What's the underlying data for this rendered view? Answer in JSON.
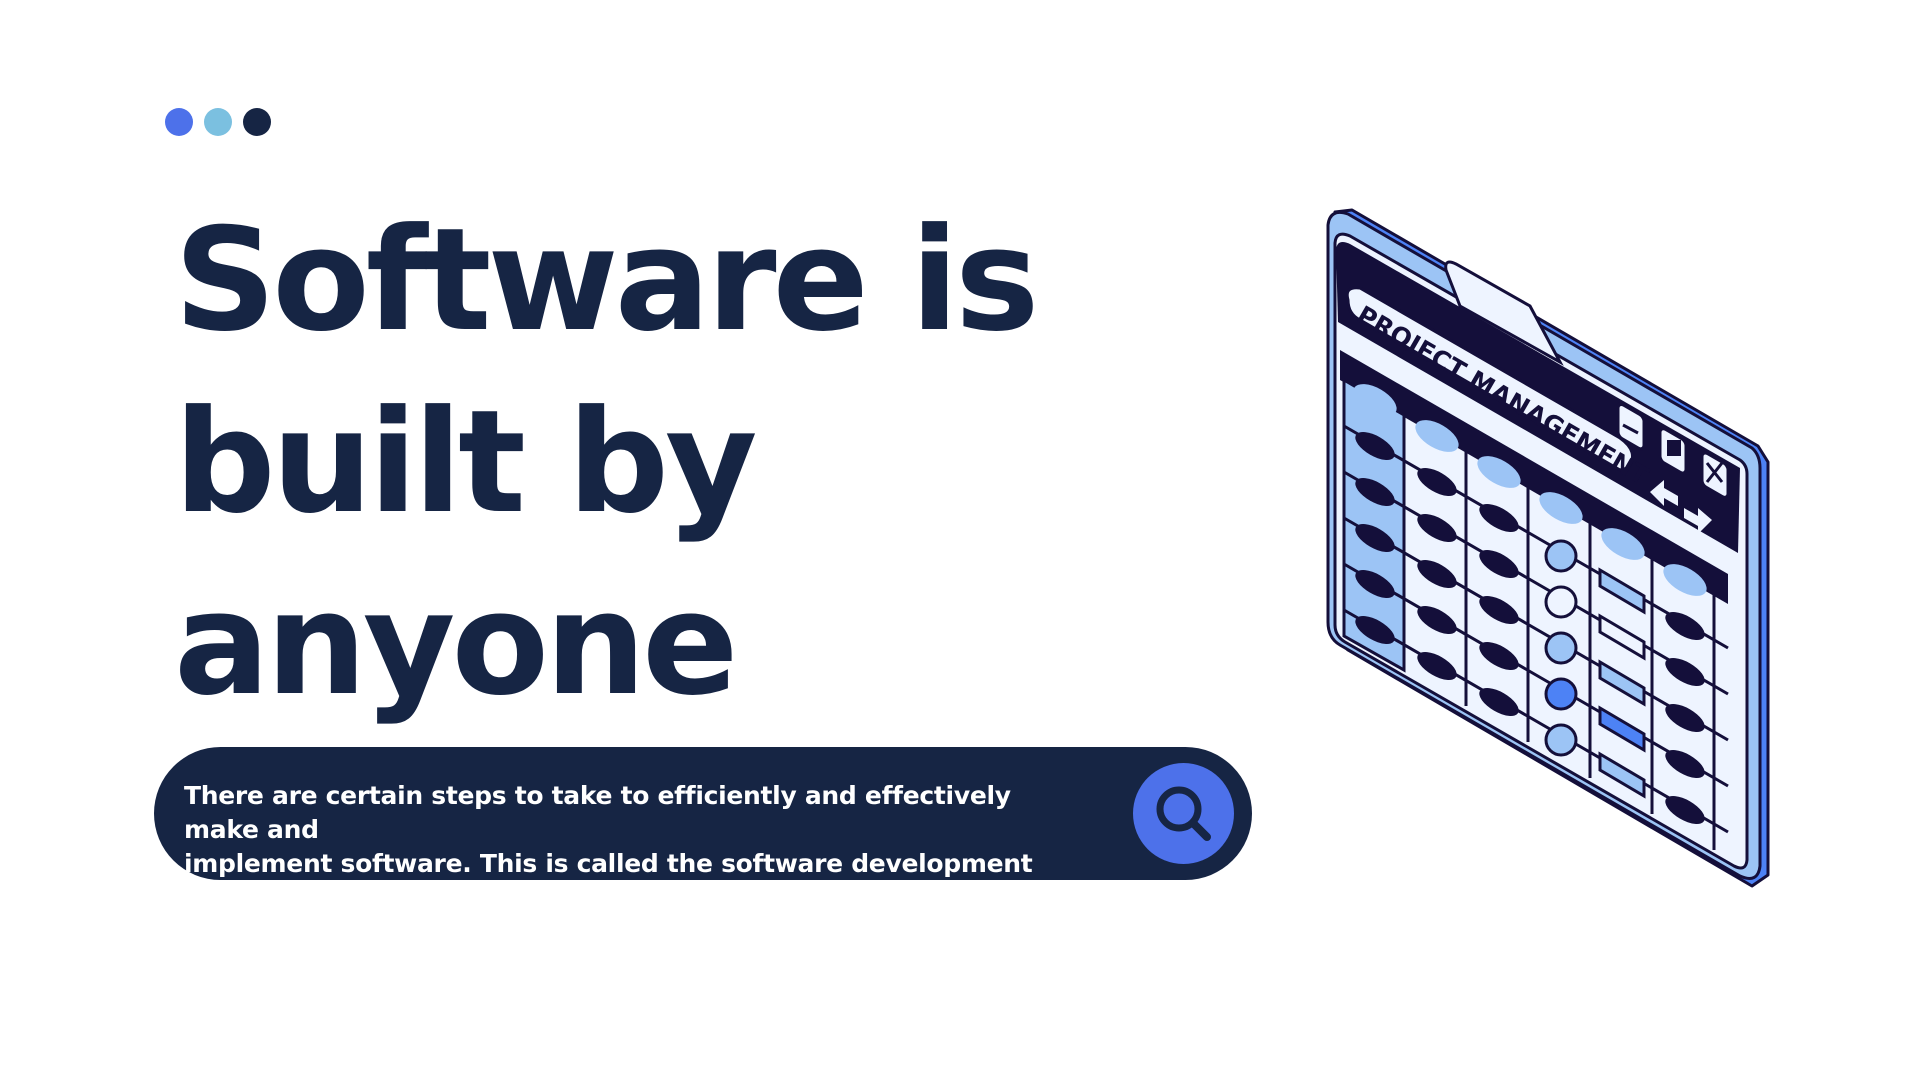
{
  "dots": [
    {
      "name": "dot-blue",
      "color": "#4d71ea"
    },
    {
      "name": "dot-light-blue",
      "color": "#7bc0e0"
    },
    {
      "name": "dot-navy",
      "color": "#162544"
    }
  ],
  "headline": {
    "line1": "Software is",
    "line2": "built by",
    "line3": "anyone"
  },
  "description": {
    "line1": "There are certain steps to take to efficiently and effectively make and",
    "line2": "implement software. This is called the software development life cycle"
  },
  "search_button": {
    "icon": "search-icon",
    "color": "#4d71ea"
  },
  "illustration": {
    "title": "PROJECT MANAGEMENT",
    "icons": [
      "minimize-icon",
      "restore-icon",
      "close-icon",
      "arrow-left-icon",
      "arrow-right-icon",
      "user-icon"
    ]
  },
  "colors": {
    "navy": "#162544",
    "accent": "#4d71ea",
    "light_blue": "#9cc4f5",
    "pale": "#eef4ff"
  }
}
